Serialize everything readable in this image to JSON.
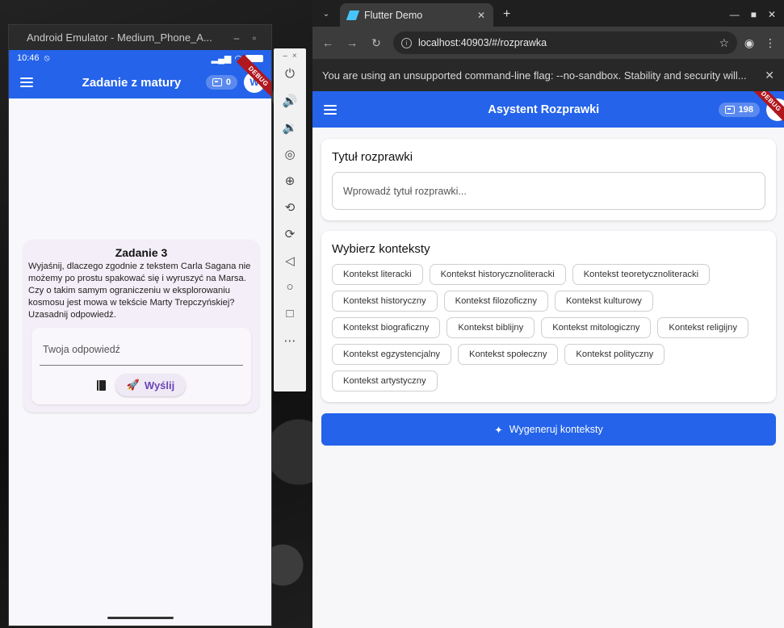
{
  "emulator": {
    "window_title": "Android Emulator - Medium_Phone_A...",
    "min_glyph": "–",
    "max_glyph": "▫",
    "status_time": "10:46",
    "appbar_title": "Zadanie z matury",
    "credits": "0",
    "avatar_letter": "W",
    "debug_label": "DEBUG",
    "task": {
      "title": "Zadanie 3",
      "text": "Wyjaśnij, dlaczego zgodnie z tekstem Carla Sagana nie możemy po prostu spakować się i wyruszyć na Marsa. Czy o takim samym ograniczeniu w eksplorowaniu kosmosu jest mowa w tekście Marty Trepczyńskiej? Uzasadnij odpowiedź.",
      "answer_placeholder": "Twoja odpowiedź",
      "send_label": "Wyślij"
    }
  },
  "emulator_toolbar": {
    "items": [
      "power-icon",
      "volume-up-icon",
      "volume-down-icon",
      "camera-icon",
      "zoom-icon",
      "rotate-left-icon",
      "rotate-right-icon",
      "back-icon",
      "home-icon",
      "overview-icon",
      "more-icon"
    ]
  },
  "browser": {
    "tab_title": "Flutter Demo",
    "url": "localhost:40903/#/rozprawka",
    "infobar_message": "You are using an unsupported command-line flag: --no-sandbox. Stability and security will...",
    "app": {
      "title": "Asystent Rozprawki",
      "credits": "198",
      "avatar_letter": "W",
      "debug_label": "DEBUG",
      "title_section": {
        "heading": "Tytuł rozprawki",
        "placeholder": "Wprowadź tytuł rozprawki..."
      },
      "contexts_section": {
        "heading": "Wybierz konteksty",
        "chips": [
          "Kontekst literacki",
          "Kontekst historycznoliteracki",
          "Kontekst teoretycznoliteracki",
          "Kontekst historyczny",
          "Kontekst filozoficzny",
          "Kontekst kulturowy",
          "Kontekst biograficzny",
          "Kontekst biblijny",
          "Kontekst mitologiczny",
          "Kontekst religijny",
          "Kontekst egzystencjalny",
          "Kontekst społeczny",
          "Kontekst polityczny",
          "Kontekst artystyczny"
        ]
      },
      "generate_label": "Wygeneruj konteksty"
    }
  },
  "colors": {
    "primary": "#2463ea",
    "debug_ribbon": "#b0171f",
    "send_text": "#6a45b8"
  }
}
